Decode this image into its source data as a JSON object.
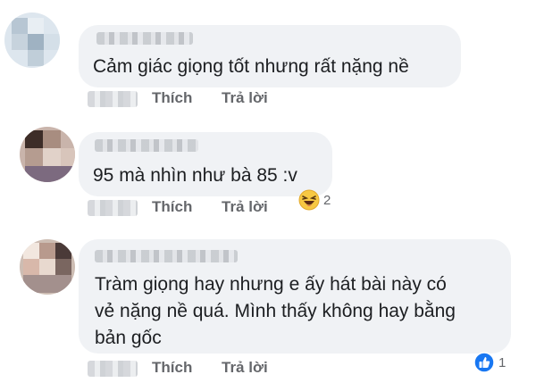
{
  "comments": [
    {
      "text": "Cảm giác giọng tốt nhưng rất nặng nề",
      "actions": {
        "like": "Thích",
        "reply": "Trả lời"
      }
    },
    {
      "text": "95 mà nhìn như bà 85 :v",
      "actions": {
        "like": "Thích",
        "reply": "Trả lời"
      },
      "reaction": {
        "icon": "haha-icon",
        "count": "2"
      }
    },
    {
      "text": "Tràm giọng hay nhưng e ấy hát bài này có\nvẻ nặng nề quá. Mình thấy không hay bằng\nbản gốc",
      "actions": {
        "like": "Thích",
        "reply": "Trả lời"
      },
      "reaction": {
        "icon": "like-icon",
        "count": "1"
      }
    }
  ],
  "colors": {
    "bubble": "#f0f2f5",
    "text": "#1c1e21",
    "action": "#65676b",
    "like_blue": "#1877f2",
    "haha_yellow": "#f7c843"
  }
}
